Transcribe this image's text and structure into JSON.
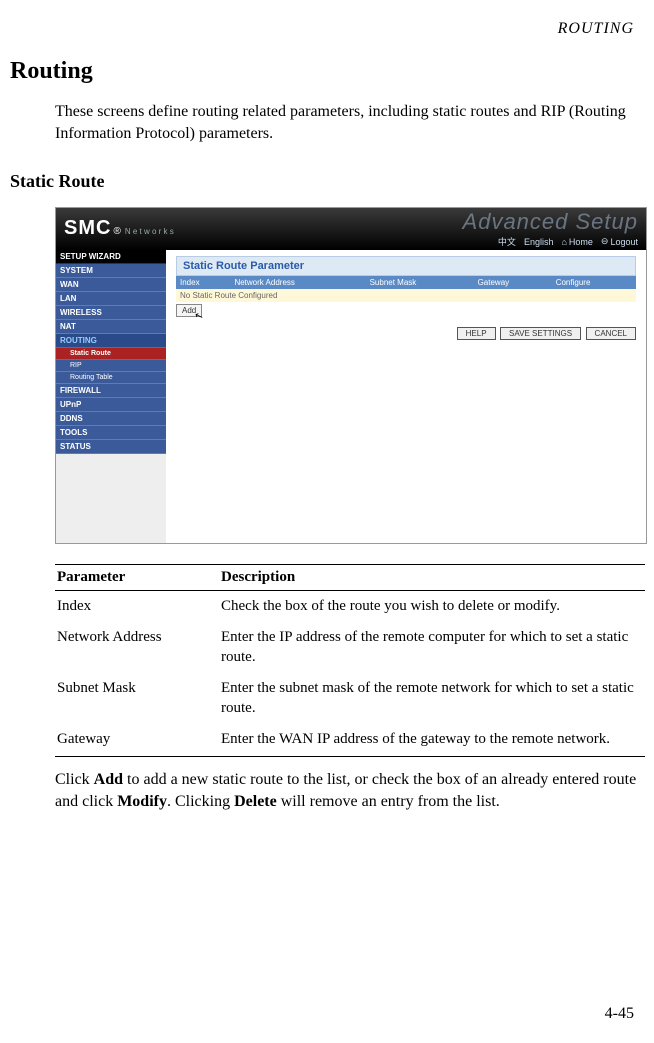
{
  "runningHead": "ROUTING",
  "heading": "Routing",
  "intro": "These screens define routing related parameters, including static routes and RIP (Routing Information Protocol) parameters.",
  "subheading": "Static Route",
  "screenshot": {
    "logo": "SMC",
    "logoR": "®",
    "logoSub": "N e t w o r k s",
    "advanced": "Advanced Setup",
    "links": {
      "cn": "中文",
      "en": "English",
      "home": "Home",
      "logout": "Logout"
    },
    "sidebar": {
      "setup": "SETUP WIZARD",
      "system": "SYSTEM",
      "wan": "WAN",
      "lan": "LAN",
      "wireless": "WIRELESS",
      "nat": "NAT",
      "routing": "ROUTING",
      "staticRoute": "Static Route",
      "rip": "RIP",
      "routingTable": "Routing Table",
      "firewall": "FIREWALL",
      "upnp": "UPnP",
      "ddns": "DDNS",
      "tools": "TOOLS",
      "status": "STATUS"
    },
    "panel": {
      "title": "Static Route Parameter",
      "cols": {
        "index": "Index",
        "netaddr": "Network Address",
        "subnet": "Subnet Mask",
        "gateway": "Gateway",
        "configure": "Configure"
      },
      "empty": "No Static Route Configured",
      "add": "Add"
    },
    "buttons": {
      "help": "HELP",
      "save": "SAVE SETTINGS",
      "cancel": "CANCEL"
    }
  },
  "table": {
    "headParam": "Parameter",
    "headDesc": "Description",
    "rows": [
      {
        "p": "Index",
        "d": "Check the box of the route you wish to delete or modify."
      },
      {
        "p": "Network Address",
        "d": "Enter the IP address of the remote computer for which to set a static route."
      },
      {
        "p": "Subnet Mask",
        "d": "Enter the subnet mask of the remote network for which to set a static route."
      },
      {
        "p": "Gateway",
        "d": "Enter the WAN IP address of the gateway to the remote network."
      }
    ]
  },
  "after": {
    "t1": "Click ",
    "b1": "Add",
    "t2": " to add a new static route to the list, or check the box of an already entered route and click ",
    "b2": "Modify",
    "t3": ". Clicking ",
    "b3": "Delete",
    "t4": " will remove an entry from the list."
  },
  "pageNum": "4-45"
}
